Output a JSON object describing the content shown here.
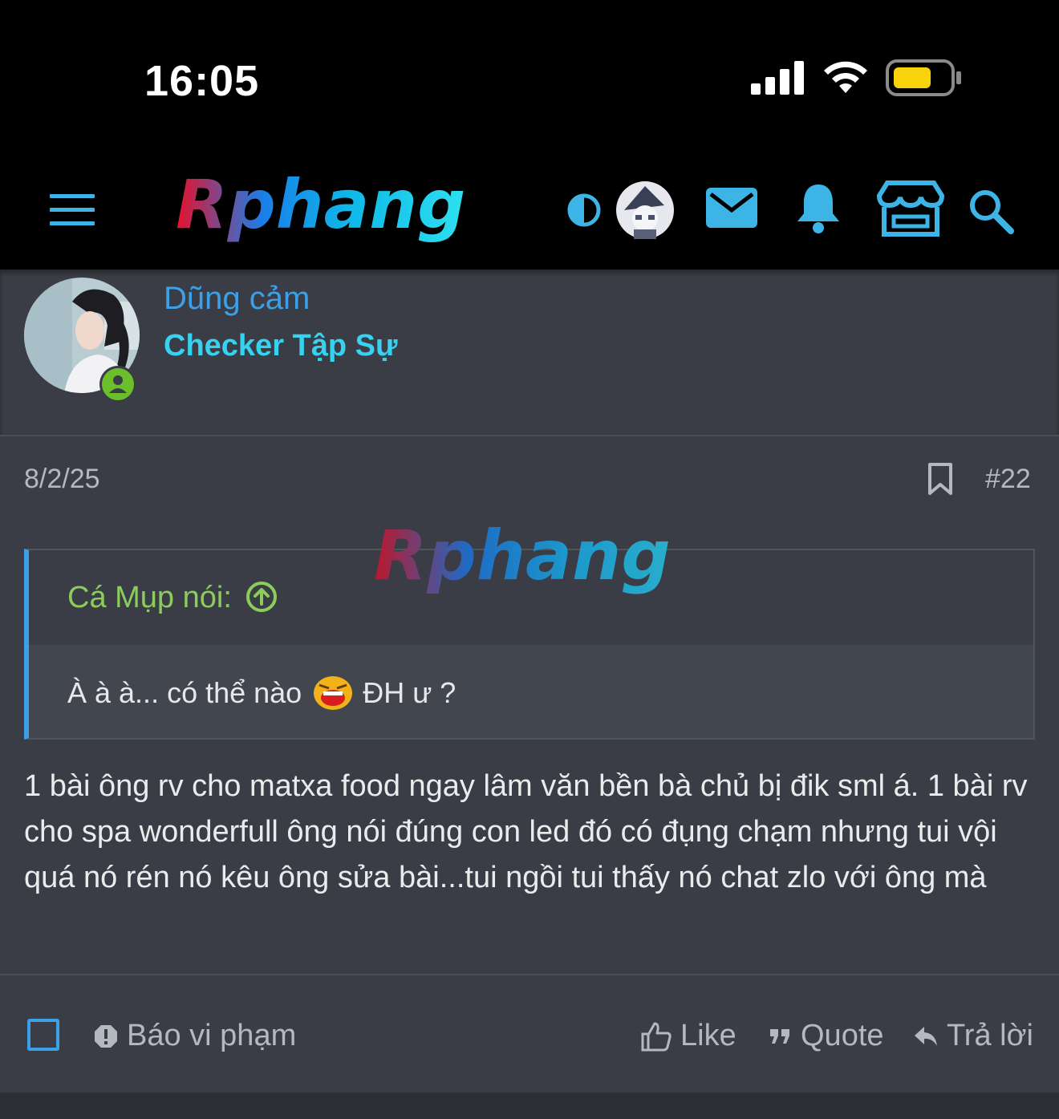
{
  "status": {
    "time": "16:05"
  },
  "nav": {
    "logo_text": "Rphang",
    "icons": [
      "menu-icon",
      "theme-toggle-icon",
      "avatar",
      "mail-icon",
      "bell-icon",
      "store-icon",
      "search-icon"
    ]
  },
  "author": {
    "name": "Dũng cảm",
    "title": "Checker Tập Sự"
  },
  "post": {
    "date": "8/2/25",
    "number": "#22",
    "quote": {
      "author": "Cá Mụp nói:",
      "text_before": "À à à... có thể nào",
      "text_after": "ĐH ư ?"
    },
    "message": "1 bài ông rv cho matxa food ngay lâm văn bền bà chủ bị đik sml á. 1 bài rv cho spa wonderfull ông nói đúng con led đó có đụng chạm nhưng tui vội quá nó rén nó kêu ông sửa bài...tui ngồi tui thấy nó chat zlo với ông mà"
  },
  "actions": {
    "report": "Báo vi phạm",
    "like": "Like",
    "quote": "Quote",
    "reply": "Trả lời"
  },
  "colors": {
    "accent": "#3ca0e6",
    "title": "#36d2f0",
    "quote_author": "#8ccc5a",
    "background": "#3a3d45"
  }
}
